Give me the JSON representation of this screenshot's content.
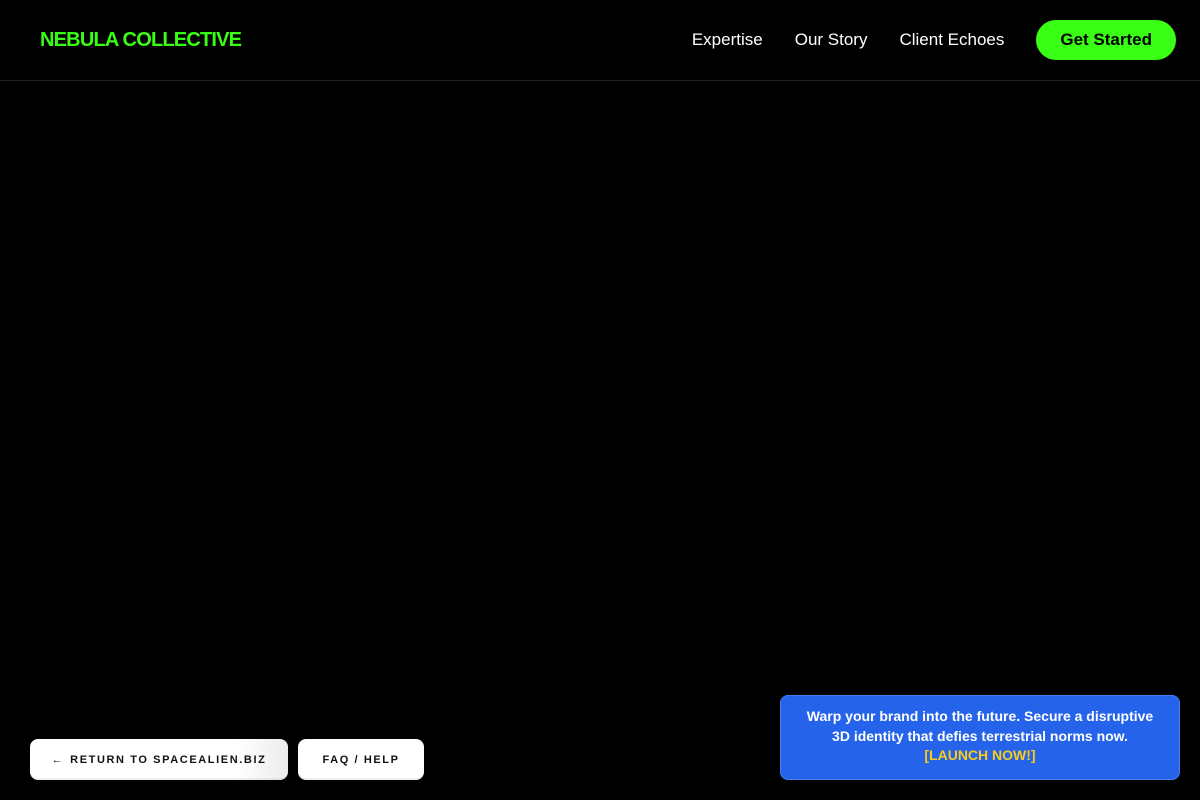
{
  "header": {
    "brand": "NEBULA COLLECTIVE",
    "nav": [
      {
        "label": "Expertise"
      },
      {
        "label": "Our Story"
      },
      {
        "label": "Client Echoes"
      }
    ],
    "cta_label": "Get Started"
  },
  "footer_buttons": {
    "return_label": "RETURN TO SPACEALIEN.BIZ",
    "return_icon": "left-arrow-icon",
    "faq_label": "FAQ / HELP"
  },
  "promo": {
    "text": "Warp your brand into the future. Secure a disruptive 3D identity that defies terrestrial norms now.",
    "link_label": "[LAUNCH NOW!]"
  },
  "colors": {
    "background": "#000000",
    "accent_green": "#39ff14",
    "promo_blue": "#2563eb",
    "promo_link_yellow": "#facc15"
  }
}
